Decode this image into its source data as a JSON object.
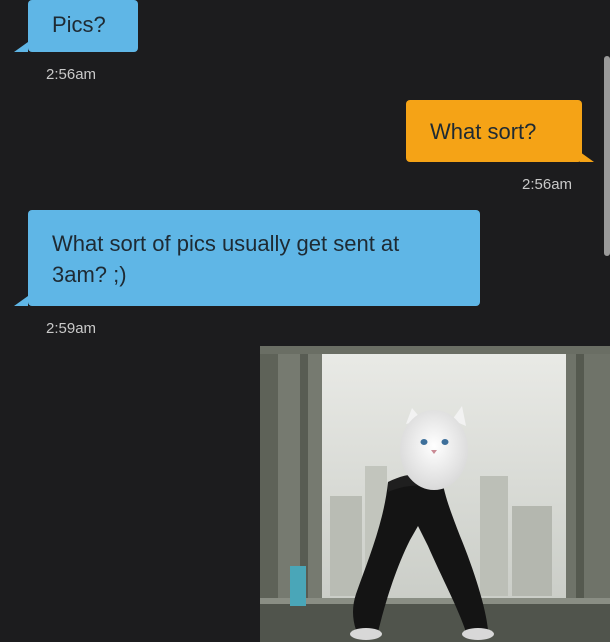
{
  "messages": [
    {
      "text": "Pics?",
      "time": "2:56am",
      "direction": "incoming"
    },
    {
      "text": "What sort?",
      "time": "2:56am",
      "direction": "outgoing"
    },
    {
      "text": "What sort of pics usually get sent at 3am? ;)",
      "time": "2:59am",
      "direction": "incoming"
    }
  ],
  "attachment": {
    "type": "image",
    "icon": "cat-meme-photo"
  },
  "colors": {
    "incoming": "#5fb6e6",
    "outgoing": "#f5a316",
    "background": "#1c1c1e"
  }
}
